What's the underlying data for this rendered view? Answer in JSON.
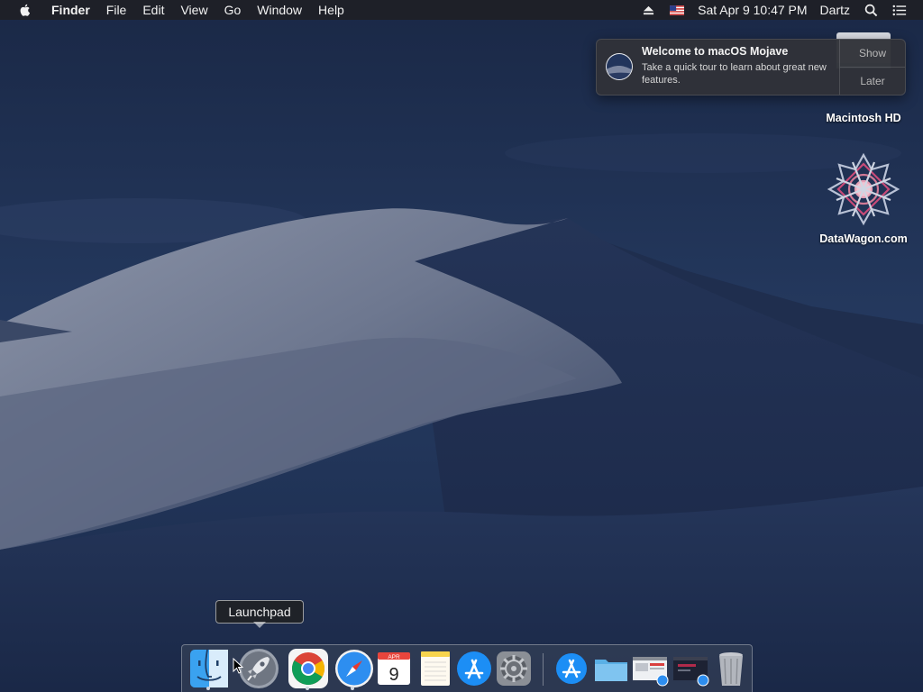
{
  "menubar": {
    "app_name": "Finder",
    "menus": [
      "File",
      "Edit",
      "View",
      "Go",
      "Window",
      "Help"
    ],
    "clock": "Sat Apr 9  10:47 PM",
    "user": "Dartz"
  },
  "notification": {
    "title": "Welcome to macOS Mojave",
    "body": "Take a quick tour to learn about great new features.",
    "show_label": "Show",
    "later_label": "Later"
  },
  "desktop_icons": {
    "hd_label": "Macintosh HD",
    "datawagon_label": "DataWagon.com"
  },
  "tooltip": {
    "text": "Launchpad"
  },
  "dock": {
    "calendar_month": "APR",
    "calendar_day": "9"
  }
}
